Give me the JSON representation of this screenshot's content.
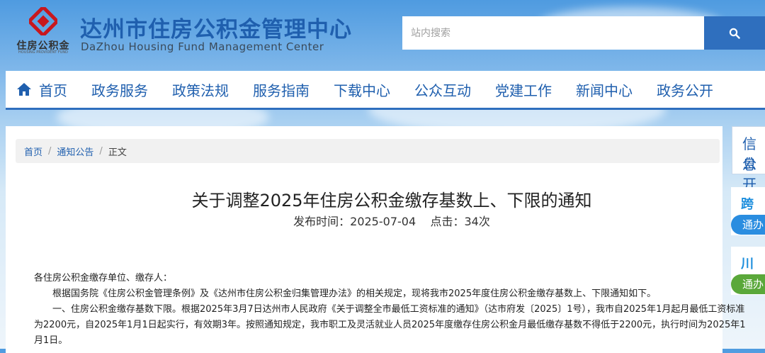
{
  "site": {
    "logo_text": "住房公积金",
    "logo_subtext": "HOUSING PROVIDENT FUND",
    "title": "达州市住房公积金管理中心",
    "subtitle": "DaZhou Housing Fund Management Center"
  },
  "search": {
    "placeholder": "站内搜索",
    "button_icon": "search-icon"
  },
  "nav": {
    "home_icon": "home-icon",
    "items": [
      "首页",
      "政务服务",
      "政策法规",
      "服务指南",
      "下载中心",
      "公众互动",
      "党建工作",
      "新闻中心",
      "政务公开"
    ]
  },
  "breadcrumb": [
    "首页",
    "通知公告",
    "正文"
  ],
  "article": {
    "title": "关于调整2025年住房公积金缴存基数上、下限的通知",
    "publish_label": "发布时间：",
    "publish_date": "2025-07-04",
    "clicks_label": "点击：",
    "clicks": "34次",
    "greeting": "各住房公积金缴存单位、缴存人：",
    "para1": "根据国务院《住房公积金管理条例》及《达州市住房公积金归集管理办法》的相关规定，现将我市2025年度住房公积金缴存基数上、下限通知如下。",
    "para2": "一、住房公积金缴存基数下限。根据2025年3月7日达州市人民政府《关于调整全市最低工资标准的通知》（达市府发〔2025〕1号），我市自2025年1月起月最低工资标准为2200元，自2025年1月1日起实行，有效期3年。按照通知规定，我市职工及灵活就业人员2025年度缴存住房公积金月最低缴存基数不得低于2200元，执行时间为2025年1月1日。"
  },
  "sidebar": {
    "info_label_line1": "信息",
    "info_label_line2": "公开",
    "card1_top": "跨省",
    "card1_button": "通办",
    "card2_top": "川渝",
    "card2_button": "通办"
  },
  "colors": {
    "brand_blue": "#1f5fae",
    "search_button": "#2f6fbe",
    "logo_red": "#c8171e",
    "card1_button": "#2a8de0",
    "card2_button": "#5aa83a"
  }
}
